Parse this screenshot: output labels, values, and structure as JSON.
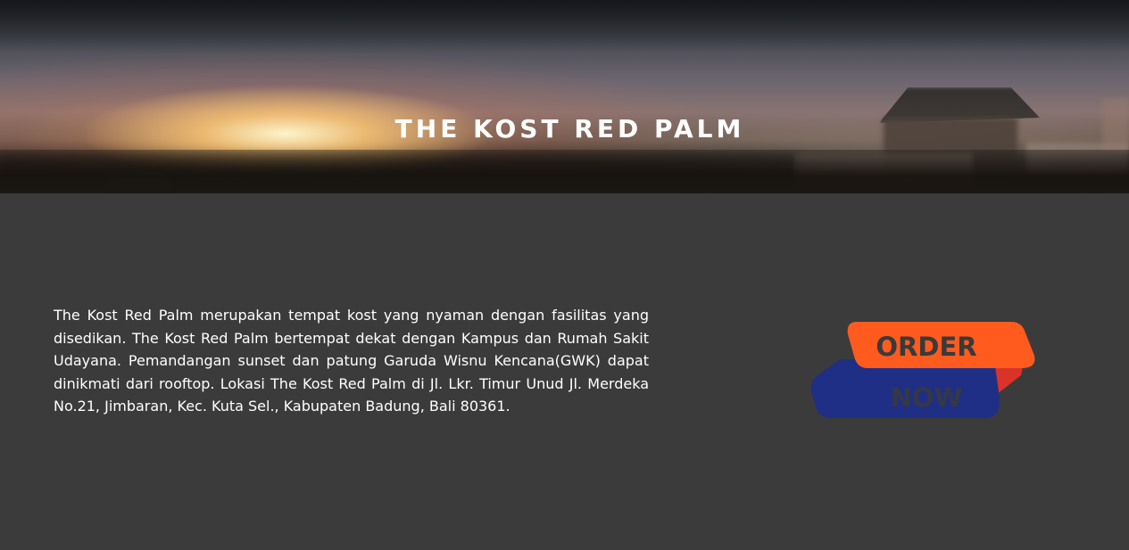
{
  "hero": {
    "title": "THE KOST RED PALM"
  },
  "about": {
    "description": "The Kost Red Palm merupakan tempat kost yang nyaman dengan fasilitas yang disedikan. The Kost Red Palm bertempat dekat dengan Kampus dan Rumah Sakit Udayana. Pemandangan sunset dan patung Garuda Wisnu Kencana(GWK) dapat dinikmati dari rooftop. Lokasi The Kost Red Palm di Jl. Lkr. Timur Unud Jl. Merdeka No.21, Jimbaran, Kec. Kuta Sel., Kabupaten Badung, Bali 80361."
  },
  "order_button": {
    "line1": "ORDER",
    "line2": "NOW"
  },
  "colors": {
    "page_background": "#3b3b3b",
    "button_orange": "#ff5b1f",
    "button_navy": "#1f2f86",
    "button_red_shadow": "#d9332a",
    "button_text": "#3a3a3a"
  }
}
